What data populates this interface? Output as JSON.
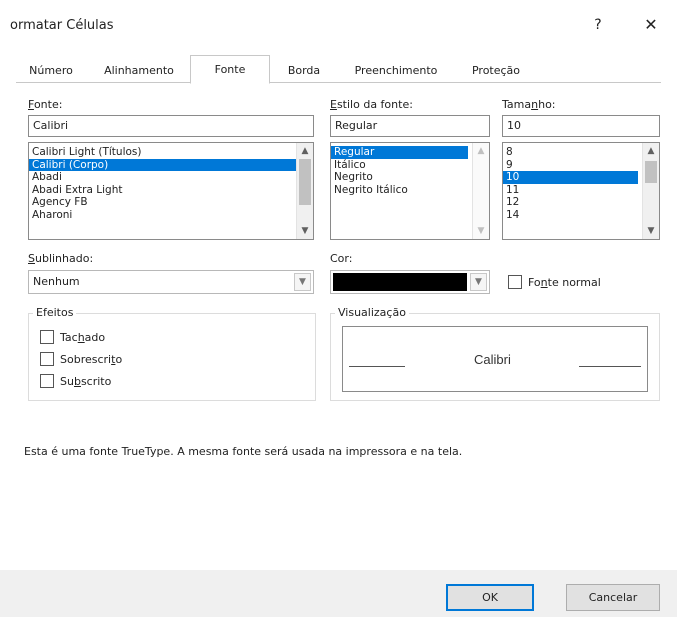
{
  "window": {
    "title": "ormatar Células",
    "help_glyph": "?",
    "close_glyph": "✕"
  },
  "tabs": [
    {
      "label": "Número",
      "active": false
    },
    {
      "label": "Alinhamento",
      "active": false
    },
    {
      "label": "Fonte",
      "active": true
    },
    {
      "label": "Borda",
      "active": false
    },
    {
      "label": "Preenchimento",
      "active": false
    },
    {
      "label": "Proteção",
      "active": false
    }
  ],
  "font": {
    "label": "Fonte:",
    "value": "Calibri",
    "items": [
      {
        "text": "Calibri Light (Títulos)",
        "selected": false
      },
      {
        "text": "Calibri (Corpo)",
        "selected": true
      },
      {
        "text": "Abadi",
        "selected": false
      },
      {
        "text": "Abadi Extra Light",
        "selected": false
      },
      {
        "text": "Agency FB",
        "selected": false
      },
      {
        "text": "Aharoni",
        "selected": false
      }
    ]
  },
  "style": {
    "label": "Estilo da fonte:",
    "value": "Regular",
    "items": [
      {
        "text": "Regular",
        "selected": true
      },
      {
        "text": "Itálico",
        "selected": false
      },
      {
        "text": "Negrito",
        "selected": false
      },
      {
        "text": "Negrito Itálico",
        "selected": false
      }
    ]
  },
  "size": {
    "label": "Tamanho:",
    "value": "10",
    "items": [
      {
        "text": "8",
        "selected": false
      },
      {
        "text": "9",
        "selected": false
      },
      {
        "text": "10",
        "selected": true
      },
      {
        "text": "11",
        "selected": false
      },
      {
        "text": "12",
        "selected": false
      },
      {
        "text": "14",
        "selected": false
      }
    ]
  },
  "underline": {
    "label": "Sublinhado:",
    "value": "Nenhum"
  },
  "color": {
    "label": "Cor:",
    "value_hex": "#000000",
    "normal_font_label": "Fonte normal"
  },
  "effects": {
    "title": "Efeitos",
    "strikethrough": "Tachado",
    "superscript": "Sobrescrito",
    "subscript": "Subscrito"
  },
  "preview": {
    "title": "Visualização",
    "sample": "Calibri"
  },
  "info_text": "Esta é uma fonte TrueType. A mesma fonte será usada na impressora e na tela.",
  "buttons": {
    "ok": "OK",
    "cancel": "Cancelar"
  },
  "colors": {
    "selection": "#0078d7",
    "default_button_border": "#0078d7",
    "footer_bg": "#f0f0f0"
  }
}
